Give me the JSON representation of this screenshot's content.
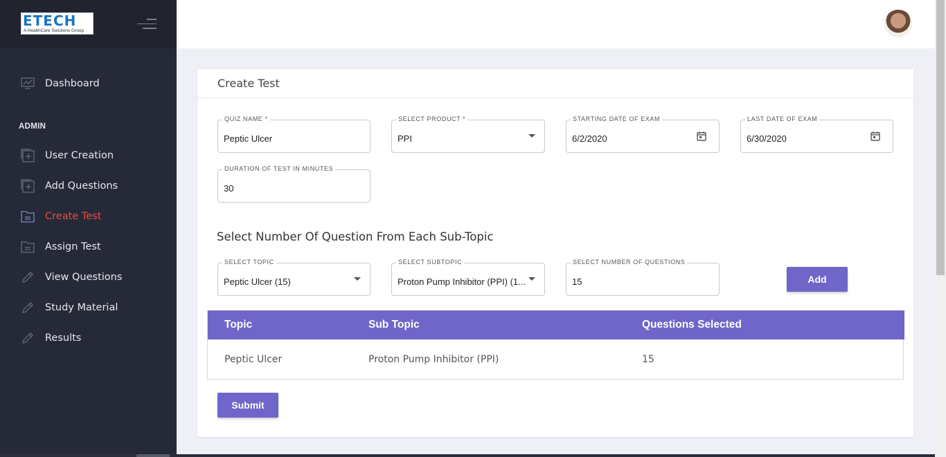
{
  "brand": {
    "logo_text": "ETECH",
    "logo_tagline": "A HealthCare Solutions Group"
  },
  "sidebar": {
    "dashboard_label": "Dashboard",
    "section_label": "ADMIN",
    "items": [
      {
        "label": "User Creation",
        "icon": "add-box-icon"
      },
      {
        "label": "Add Questions",
        "icon": "add-box-icon"
      },
      {
        "label": "Create Test",
        "icon": "folder-icon",
        "active": true
      },
      {
        "label": "Assign Test",
        "icon": "folder-icon"
      },
      {
        "label": "View Questions",
        "icon": "pencil-icon"
      },
      {
        "label": "Study Material",
        "icon": "pencil-icon"
      },
      {
        "label": "Results",
        "icon": "pencil-icon"
      }
    ],
    "active_color": "#e74c3c"
  },
  "card": {
    "title": "Create Test"
  },
  "form": {
    "quiz_name": {
      "label": "QUIZ NAME *",
      "value": "Peptic Ulcer"
    },
    "product": {
      "label": "SELECT PRODUCT *",
      "value": "PPI"
    },
    "start_date": {
      "label": "STARTING DATE OF EXAM",
      "value": "6/2/2020"
    },
    "last_date": {
      "label": "LAST DATE OF EXAM",
      "value": "6/30/2020"
    },
    "duration": {
      "label": "DURATION OF TEST IN MINUTES",
      "value": "30"
    }
  },
  "subtopic_section": {
    "heading": "Select Number Of Question From Each Sub-Topic",
    "topic": {
      "label": "SELECT TOPIC",
      "value": "Peptic Ulcer (15)"
    },
    "subtopic": {
      "label": "SELECT SUBTOPIC",
      "value": "Proton Pump Inhibitor (PPI) (1..."
    },
    "num_questions": {
      "label": "SELECT NUMBER OF QUESTIONS",
      "value": "15"
    },
    "add_label": "Add"
  },
  "table": {
    "headers": [
      "Topic",
      "Sub Topic",
      "Questions Selected"
    ],
    "rows": [
      [
        "Peptic Ulcer",
        "Proton Pump Inhibitor (PPI)",
        "15"
      ]
    ]
  },
  "submit_label": "Submit",
  "colors": {
    "accent": "#7066c9",
    "sidebar_bg": "#262a38"
  }
}
